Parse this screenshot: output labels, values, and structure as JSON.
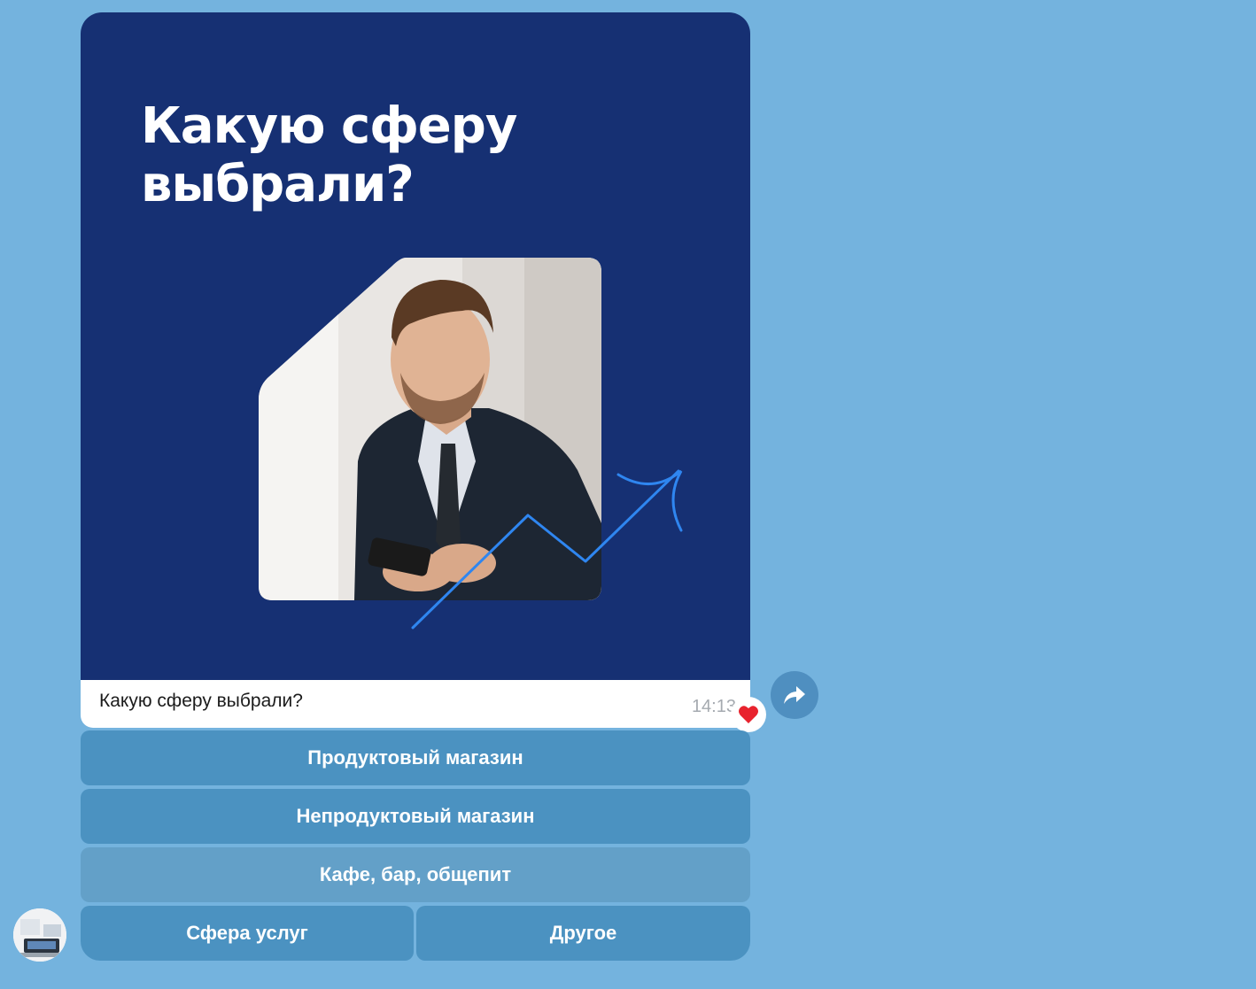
{
  "image": {
    "title": "Какую сферу\nвыбрали?",
    "background_color": "#163073",
    "accent_color": "#2f86f0"
  },
  "message": {
    "caption": "Какую сферу выбрали?",
    "time": "14:13",
    "reaction": "heart-icon"
  },
  "keyboard": {
    "buttons": [
      {
        "label": "Продуктовый магазин"
      },
      {
        "label": "Непродуктовый магазин"
      },
      {
        "label": "Кафе, бар, общепит"
      },
      {
        "label": "Сфера услуг"
      },
      {
        "label": "Другое"
      }
    ]
  },
  "colors": {
    "chat_background": "#74b3de",
    "button": "#4b92c1",
    "button_pressed": "#63a0c8"
  }
}
